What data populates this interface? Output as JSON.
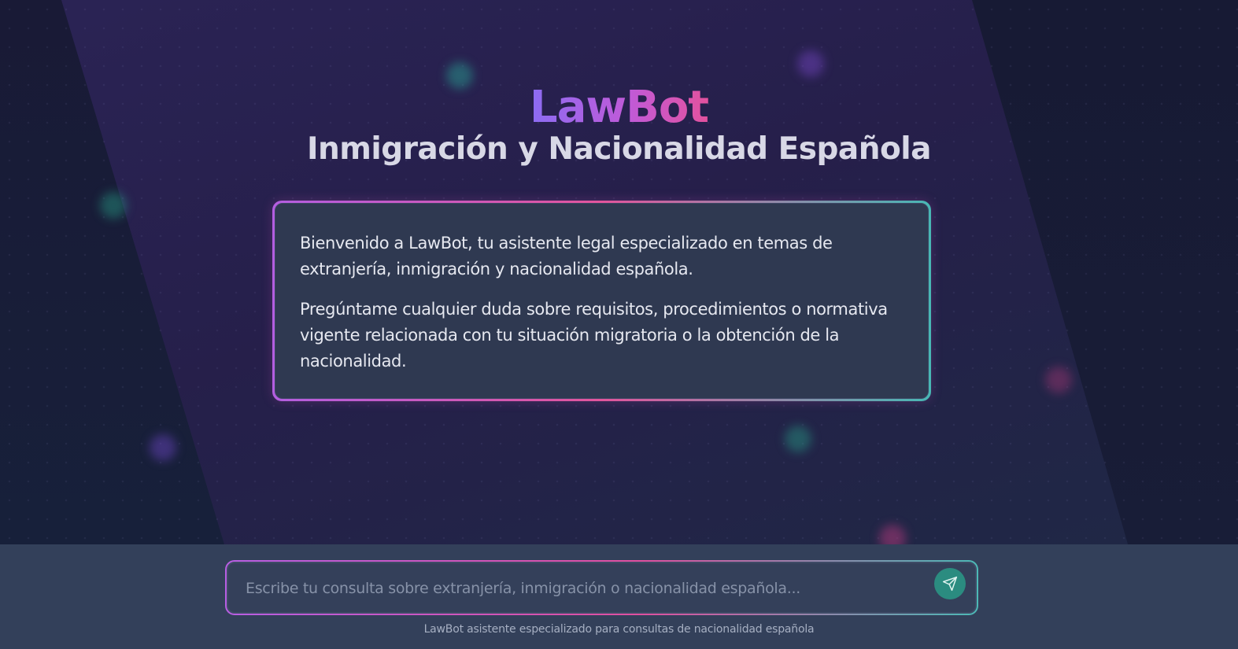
{
  "header": {
    "logo": "LawBot",
    "subtitle": "Inmigración y Nacionalidad Española"
  },
  "welcome": {
    "paragraphs": [
      "Bienvenido a LawBot, tu asistente legal especializado en temas de extranjería, inmigración y nacionalidad española.",
      "Pregúntame cualquier duda sobre requisitos, procedimientos o normativa vigente relacionada con tu situación migratoria o la obtención de la nacionalidad."
    ]
  },
  "chat": {
    "input_value": "",
    "input_placeholder": "Escribe tu consulta sobre extranjería, inmigración o nacionalidad española...",
    "send_icon": "send-icon"
  },
  "footer": {
    "note": "LawBot asistente especializado para consultas de nacionalidad española"
  },
  "colors": {
    "accent_purple": "#8b6cf3",
    "accent_pink": "#e3529e",
    "accent_teal": "#2b8c80",
    "card_bg": "#2f3951",
    "footer_bg": "#33405a"
  }
}
